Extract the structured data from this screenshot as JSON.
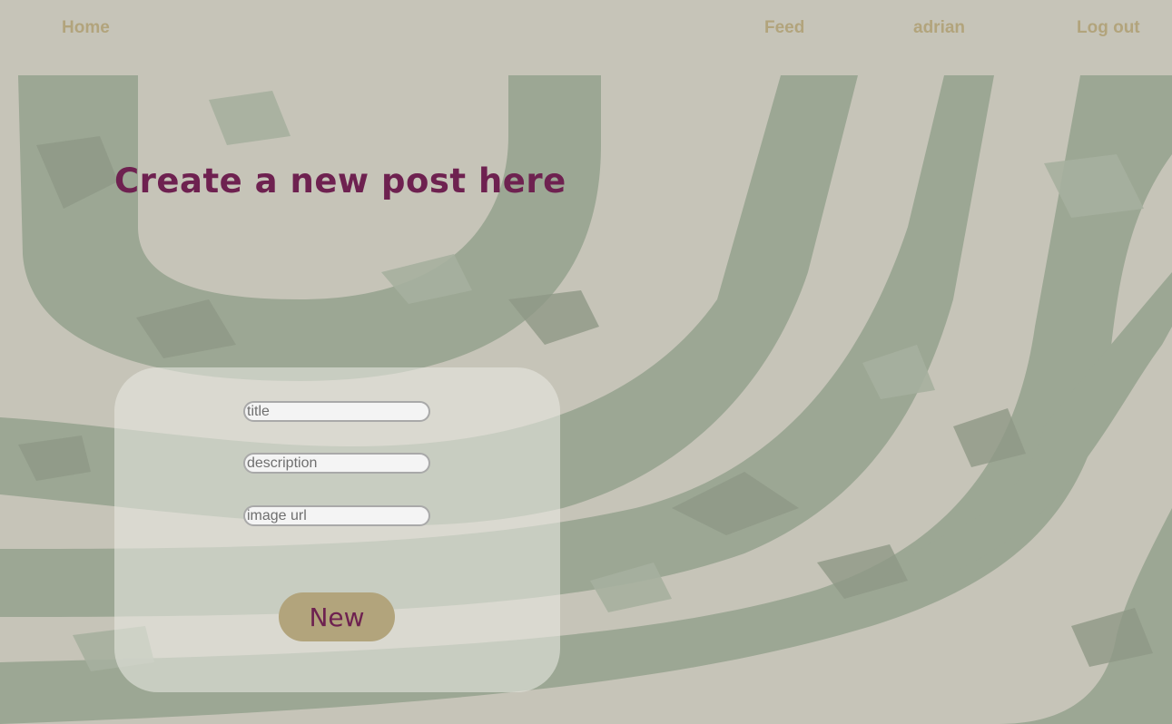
{
  "nav": {
    "home": "Home",
    "feed": "Feed",
    "user": "adrian",
    "logout": "Log out"
  },
  "page": {
    "heading": "Create a new post here"
  },
  "form": {
    "title_placeholder": "title",
    "title_value": "",
    "description_placeholder": "description",
    "description_value": "",
    "image_url_placeholder": "image url",
    "image_url_value": "",
    "submit_label": "New"
  },
  "colors": {
    "background": "#c6c4b8",
    "nav_link": "#b2a47c",
    "heading": "#6e2150",
    "button_bg": "#b2a47c",
    "button_text": "#6e2150",
    "art_green": "#9aa592"
  }
}
